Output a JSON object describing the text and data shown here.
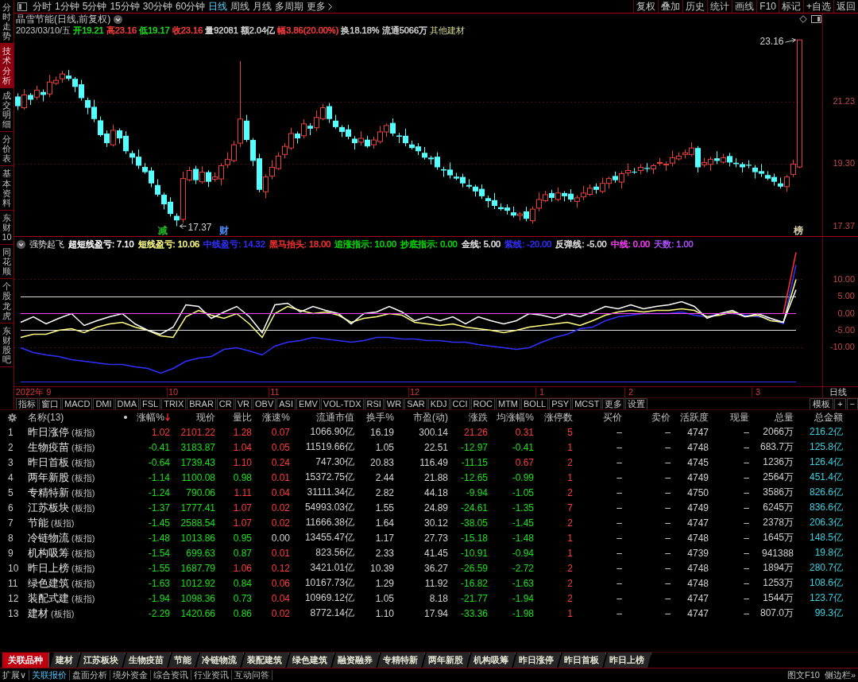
{
  "sidebar": {
    "tabs": [
      {
        "label": "分时走势",
        "selected": false
      },
      {
        "label": "技术分析",
        "selected": true
      },
      {
        "label": "成交明细",
        "selected": false
      },
      {
        "label": "分价表",
        "selected": false
      },
      {
        "label": "基本资料",
        "selected": false
      },
      {
        "label": "东财10",
        "selected": false
      },
      {
        "label": "同花顺",
        "selected": false
      },
      {
        "label": "个股龙虎",
        "selected": false
      },
      {
        "label": "东财股吧",
        "selected": false
      }
    ]
  },
  "toolbar": {
    "periods": [
      {
        "label": "分时",
        "selected": false
      },
      {
        "label": "1分钟",
        "selected": false
      },
      {
        "label": "5分钟",
        "selected": false
      },
      {
        "label": "15分钟",
        "selected": false
      },
      {
        "label": "30分钟",
        "selected": false
      },
      {
        "label": "60分钟",
        "selected": false
      },
      {
        "label": "日线",
        "selected": true
      },
      {
        "label": "周线",
        "selected": false
      },
      {
        "label": "月线",
        "selected": false
      },
      {
        "label": "多周期",
        "selected": false
      }
    ],
    "more": "更多",
    "actions": [
      "复权",
      "叠加",
      "历史",
      "统计",
      "画线",
      "F10",
      "标记",
      "+自选",
      "返回"
    ]
  },
  "price_chart": {
    "title": "晶雪节能(日线,前复权)",
    "date": "2023/03/10/五",
    "quote": [
      {
        "label": "开",
        "value": "19.21",
        "color": "#19e019"
      },
      {
        "label": "高",
        "value": "23.16",
        "color": "#ff3c3c"
      },
      {
        "label": "低",
        "value": "19.17",
        "color": "#19e019"
      },
      {
        "label": "收",
        "value": "23.16",
        "color": "#ff3c3c"
      },
      {
        "label": "量",
        "value": "92081",
        "color": "#d2d2d2"
      },
      {
        "label": "额",
        "value": "2.04亿",
        "color": "#d2d2d2"
      },
      {
        "label": "幅",
        "value": "3.86(20.00%)",
        "color": "#ff3c3c"
      },
      {
        "label": "换",
        "value": "18.18%",
        "color": "#d2d2d2"
      },
      {
        "label": "流通",
        "value": "5066万",
        "color": "#d2d2d2"
      }
    ],
    "industry": "其他建材",
    "event_marks": [
      {
        "label": "减",
        "color": "#20c020"
      },
      {
        "label": "财",
        "color": "#5090ff"
      },
      {
        "label": "榜",
        "color": "#d8d0a8"
      }
    ],
    "chart_data": {
      "type": "candlestick",
      "categories": [
        null,
        null,
        null,
        null,
        null,
        null,
        null,
        null,
        null,
        null,
        null,
        null,
        null,
        null,
        null,
        null,
        null,
        null,
        null,
        null,
        null,
        null,
        null,
        null,
        null,
        null,
        null,
        null,
        null,
        null,
        null,
        null,
        null,
        null,
        null,
        null,
        null,
        null,
        null,
        null,
        null,
        null,
        null,
        null,
        null,
        null,
        null,
        null,
        null,
        null,
        null,
        null,
        null,
        null,
        null,
        null,
        null,
        null,
        null,
        null,
        null,
        null,
        null,
        null,
        null,
        null,
        null,
        null,
        null,
        null,
        null,
        null,
        null,
        null,
        null,
        null,
        null,
        null,
        null,
        null,
        null,
        null,
        null,
        null,
        null,
        null,
        null,
        null,
        null,
        null,
        null,
        null,
        null,
        null,
        null,
        null,
        null,
        null,
        null,
        null,
        null,
        null,
        null,
        null,
        null,
        null,
        null,
        null,
        null,
        null,
        null,
        null,
        null,
        null,
        null,
        null,
        null,
        null,
        null,
        null,
        null,
        null,
        null,
        null
      ],
      "ohlc": [
        [
          21.4,
          21.5,
          20.98,
          21.1
        ],
        [
          21.05,
          21.63,
          20.99,
          21.45
        ],
        [
          21.45,
          21.51,
          21.14,
          21.3
        ],
        [
          21.38,
          21.74,
          21.3,
          21.6
        ],
        [
          21.54,
          21.62,
          21.25,
          21.45
        ],
        [
          21.48,
          22.07,
          21.38,
          21.85
        ],
        [
          21.81,
          22.02,
          21.76,
          21.9
        ],
        [
          21.95,
          22.2,
          21.83,
          22.1
        ],
        [
          22.05,
          22.23,
          21.89,
          21.95
        ],
        [
          21.95,
          22.01,
          21.54,
          21.7
        ],
        [
          21.78,
          21.92,
          21.27,
          21.35
        ],
        [
          21.29,
          21.37,
          20.85,
          21.05
        ],
        [
          21.08,
          21.3,
          20.6,
          20.7
        ],
        [
          20.66,
          20.78,
          20.15,
          20.2
        ],
        [
          20.25,
          20.35,
          19.83,
          19.95
        ],
        [
          19.9,
          20.53,
          19.84,
          20.35
        ],
        [
          20.35,
          20.41,
          19.94,
          20.1
        ],
        [
          20.18,
          20.32,
          19.62,
          19.7
        ],
        [
          19.64,
          19.72,
          19.3,
          19.5
        ],
        [
          19.53,
          19.75,
          19.15,
          19.25
        ],
        [
          19.21,
          19.33,
          19.0,
          19.05
        ],
        [
          19.1,
          19.2,
          18.58,
          18.7
        ],
        [
          18.65,
          18.83,
          18.29,
          18.35
        ],
        [
          18.35,
          18.41,
          17.89,
          18.05
        ],
        [
          18.13,
          18.27,
          17.67,
          17.75
        ],
        [
          17.69,
          17.77,
          17.37,
          17.55
        ],
        [
          17.58,
          19.07,
          17.48,
          18.85
        ],
        [
          18.81,
          19.22,
          18.76,
          19.1
        ],
        [
          19.15,
          19.25,
          18.68,
          18.8
        ],
        [
          18.75,
          19.23,
          18.69,
          19.05
        ],
        [
          19.05,
          19.11,
          18.59,
          18.75
        ],
        [
          18.83,
          19.04,
          18.75,
          18.9
        ],
        [
          18.84,
          19.33,
          18.64,
          19.25
        ],
        [
          19.28,
          19.67,
          19.18,
          19.45
        ],
        [
          19.41,
          20.02,
          19.36,
          19.9
        ],
        [
          19.95,
          22.5,
          19.83,
          20.7
        ],
        [
          20.65,
          20.83,
          19.99,
          20.05
        ],
        [
          20.05,
          20.11,
          19.24,
          19.4
        ],
        [
          19.48,
          19.62,
          18.42,
          18.5
        ],
        [
          18.44,
          18.98,
          18.24,
          18.9
        ],
        [
          18.93,
          19.42,
          18.83,
          19.2
        ],
        [
          19.16,
          19.67,
          19.11,
          19.55
        ],
        [
          19.6,
          19.95,
          19.48,
          19.85
        ],
        [
          19.8,
          20.43,
          19.74,
          20.25
        ],
        [
          20.25,
          20.31,
          19.94,
          20.1
        ],
        [
          20.18,
          20.69,
          20.1,
          20.55
        ],
        [
          20.49,
          20.57,
          20.2,
          20.4
        ],
        [
          20.43,
          20.97,
          20.33,
          20.75
        ],
        [
          20.71,
          21.17,
          20.66,
          21.05
        ],
        [
          21.1,
          21.2,
          20.58,
          20.7
        ],
        [
          20.65,
          20.83,
          20.39,
          20.45
        ],
        [
          20.45,
          20.51,
          20.14,
          20.3
        ],
        [
          20.38,
          20.52,
          20.07,
          20.15
        ],
        [
          20.09,
          20.17,
          19.75,
          19.95
        ],
        [
          19.98,
          20.32,
          19.88,
          20.1
        ],
        [
          20.06,
          20.18,
          19.8,
          19.85
        ],
        [
          19.9,
          20.15,
          19.78,
          20.05
        ],
        [
          20.0,
          20.48,
          19.94,
          20.3
        ],
        [
          20.3,
          20.56,
          20.14,
          20.5
        ],
        [
          20.58,
          20.72,
          20.17,
          20.25
        ],
        [
          20.19,
          20.27,
          19.95,
          20.15
        ],
        [
          20.18,
          20.4,
          19.85,
          19.95
        ],
        [
          19.91,
          20.03,
          19.75,
          19.8
        ],
        [
          19.85,
          19.95,
          19.58,
          19.7
        ],
        [
          19.65,
          19.83,
          19.44,
          19.5
        ],
        [
          19.5,
          19.56,
          19.29,
          19.45
        ],
        [
          19.53,
          19.67,
          19.12,
          19.2
        ],
        [
          19.14,
          19.22,
          18.9,
          19.1
        ],
        [
          19.13,
          19.35,
          18.85,
          18.95
        ],
        [
          18.91,
          19.03,
          18.8,
          18.85
        ],
        [
          18.9,
          19.0,
          18.58,
          18.7
        ],
        [
          18.65,
          18.83,
          18.54,
          18.6
        ],
        [
          18.6,
          18.66,
          18.29,
          18.45
        ],
        [
          18.53,
          18.67,
          18.22,
          18.3
        ],
        [
          18.24,
          18.32,
          17.95,
          18.15
        ],
        [
          18.18,
          18.4,
          17.9,
          18.0
        ],
        [
          17.96,
          18.08,
          17.85,
          17.9
        ],
        [
          17.95,
          18.05,
          17.73,
          17.85
        ],
        [
          17.8,
          17.98,
          17.64,
          17.7
        ],
        [
          17.7,
          17.81,
          17.54,
          17.75
        ],
        [
          17.83,
          17.97,
          17.52,
          17.6
        ],
        [
          17.54,
          17.98,
          17.45,
          17.9
        ],
        [
          17.93,
          18.42,
          17.83,
          18.2
        ],
        [
          18.16,
          18.47,
          18.11,
          18.35
        ],
        [
          18.4,
          18.5,
          18.13,
          18.25
        ],
        [
          18.2,
          18.58,
          18.14,
          18.4
        ],
        [
          18.4,
          18.46,
          18.14,
          18.3
        ],
        [
          18.38,
          18.52,
          18.12,
          18.2
        ],
        [
          18.14,
          18.33,
          17.94,
          18.25
        ],
        [
          18.28,
          18.62,
          18.18,
          18.4
        ],
        [
          18.36,
          18.67,
          18.31,
          18.55
        ],
        [
          18.6,
          18.7,
          18.38,
          18.5
        ],
        [
          18.45,
          18.88,
          18.39,
          18.7
        ],
        [
          18.7,
          18.91,
          18.54,
          18.85
        ],
        [
          18.93,
          19.07,
          18.72,
          18.8
        ],
        [
          18.74,
          19.08,
          18.54,
          19.0
        ],
        [
          19.03,
          19.32,
          18.93,
          19.1
        ],
        [
          19.06,
          19.18,
          19.0,
          19.05
        ],
        [
          19.1,
          19.3,
          18.98,
          19.2
        ],
        [
          19.18,
          19.33,
          19.05,
          19.15
        ],
        [
          19.15,
          19.31,
          18.99,
          19.25
        ],
        [
          19.33,
          19.49,
          19.25,
          19.35
        ],
        [
          19.29,
          19.38,
          19.09,
          19.3
        ],
        [
          19.33,
          19.72,
          19.23,
          19.5
        ],
        [
          19.46,
          19.67,
          19.41,
          19.55
        ],
        [
          19.6,
          19.75,
          19.48,
          19.65
        ],
        [
          19.6,
          19.98,
          19.54,
          19.8
        ],
        [
          19.8,
          19.86,
          19.04,
          19.2
        ],
        [
          19.28,
          19.49,
          19.2,
          19.35
        ],
        [
          19.29,
          19.53,
          19.09,
          19.45
        ],
        [
          19.48,
          19.7,
          19.3,
          19.4
        ],
        [
          19.36,
          19.62,
          19.31,
          19.5
        ],
        [
          19.55,
          19.65,
          19.23,
          19.35
        ],
        [
          19.34,
          19.48,
          19.2,
          19.3
        ],
        [
          19.3,
          19.36,
          19.04,
          19.2
        ],
        [
          19.28,
          19.42,
          19.17,
          19.25
        ],
        [
          19.19,
          19.27,
          18.85,
          19.05
        ],
        [
          19.08,
          19.3,
          18.9,
          19.0
        ],
        [
          18.96,
          19.08,
          18.8,
          18.85
        ],
        [
          18.9,
          19.0,
          18.63,
          18.75
        ],
        [
          18.7,
          18.88,
          18.54,
          18.6
        ],
        [
          18.6,
          18.96,
          18.44,
          18.9
        ],
        [
          18.98,
          19.44,
          18.9,
          19.3
        ],
        [
          19.21,
          23.16,
          19.17,
          23.16
        ]
      ],
      "ylim": [
        17.05,
        23.98
      ],
      "yticks": [
        {
          "value": 21.23,
          "label": "21.23"
        },
        {
          "value": 19.3,
          "label": "19.30"
        },
        {
          "value": 17.37,
          "label": "17.37"
        }
      ],
      "annotations": [
        "23.16",
        "17.37"
      ]
    }
  },
  "indicator": {
    "name": "强势起飞",
    "values": [
      {
        "label": "超短线盈亏:",
        "value": "7.10",
        "color": "#ffffff"
      },
      {
        "label": "短线盈亏:",
        "value": "10.06",
        "color": "#ffff80"
      },
      {
        "label": "中线盈亏:",
        "value": "14.32",
        "color": "#3030ff"
      },
      {
        "label": "黑马抬头:",
        "value": "18.00",
        "color": "#ff3030"
      },
      {
        "label": "追涨指示:",
        "value": "10.00",
        "color": "#00e000"
      },
      {
        "label": "抄底指示:",
        "value": "0.00",
        "color": "#00e000"
      },
      {
        "label": "金线:",
        "value": "5.00",
        "color": "#e0e0e0"
      },
      {
        "label": "紫线:",
        "value": "-20.00",
        "color": "#3030ff"
      },
      {
        "label": "反弹线:",
        "value": "-5.00",
        "color": "#e0e0e0"
      },
      {
        "label": "中线:",
        "value": "0.00",
        "color": "#ff40ff"
      },
      {
        "label": "天数:",
        "value": "1.00",
        "color": "#b050ff"
      }
    ],
    "chart_data": {
      "type": "line",
      "categories": [
        null,
        "2022年 9",
        null,
        null,
        null,
        null,
        null,
        null,
        null,
        null,
        null,
        null,
        "10",
        null,
        null,
        null,
        null,
        null,
        null,
        null,
        "11",
        null,
        null,
        null,
        null,
        null,
        null,
        null,
        null,
        null,
        null,
        "12",
        null,
        null,
        null,
        null,
        null,
        null,
        null,
        null,
        null,
        "1",
        null,
        null,
        null,
        null,
        null,
        null,
        "2",
        null,
        null,
        null,
        null,
        null,
        null,
        null,
        null,
        null,
        "3",
        null,
        null,
        null
      ],
      "ylim": [
        -21.2,
        22.6
      ],
      "yticks": [
        {
          "value": 10,
          "label": "10.00"
        },
        {
          "value": 5,
          "label": "5.00"
        },
        {
          "value": 0,
          "label": "0.00"
        },
        {
          "value": -5,
          "label": "-5.00"
        },
        {
          "value": -10,
          "label": "-10.00"
        }
      ],
      "series": [
        {
          "color": "#d8d8c0",
          "values": [
            5,
            5,
            5,
            5,
            5,
            5,
            5,
            5,
            5,
            5,
            5,
            5,
            5,
            5,
            5,
            5,
            5,
            5,
            5,
            5,
            5,
            5,
            5,
            5,
            5,
            5,
            5,
            5,
            5,
            5,
            5,
            5,
            5,
            5,
            5,
            5,
            5,
            5,
            5,
            5,
            5,
            5,
            5,
            5,
            5,
            5,
            5,
            5,
            5,
            5,
            5,
            5,
            5,
            5,
            5,
            5,
            5,
            5,
            5,
            5,
            5,
            5
          ]
        },
        {
          "color": "#e0e0e0",
          "values": [
            -5,
            -5,
            -5,
            -5,
            -5,
            -5,
            -5,
            -5,
            -5,
            -5,
            -5,
            -5,
            -5,
            -5,
            -5,
            -5,
            -5,
            -5,
            -5,
            -5,
            -5,
            -5,
            -5,
            -5,
            -5,
            -5,
            -5,
            -5,
            -5,
            -5,
            -5,
            -5,
            -5,
            -5,
            -5,
            -5,
            -5,
            -5,
            -5,
            -5,
            -5,
            -5,
            -5,
            -5,
            -5,
            -5,
            -5,
            -5,
            -5,
            -5,
            -5,
            -5,
            -5,
            -5,
            -5,
            -5,
            -5,
            -5,
            -5,
            -5,
            -5,
            -5
          ]
        },
        {
          "color": "#3030ff",
          "values": [
            -20,
            -20,
            -20,
            -20,
            -20,
            -20,
            -20,
            -20,
            -20,
            -20,
            -20,
            -20,
            -20,
            -20,
            -20,
            -20,
            -20,
            -20,
            -20,
            -20,
            -20,
            -20,
            -20,
            -20,
            -20,
            -20,
            -20,
            -20,
            -20,
            -20,
            -20,
            -20,
            -20,
            -20,
            -20,
            -20,
            -20,
            -20,
            -20,
            -20,
            -20,
            -20,
            -20,
            -20,
            -20,
            -20,
            -20,
            -20,
            -20,
            -20,
            -20,
            -20,
            -20,
            -20,
            -20,
            -20,
            -20,
            -20,
            -20,
            -20,
            -20,
            -20
          ]
        },
        {
          "color": "#3030ff",
          "values": [
            -10.0,
            -11.5,
            -12.0,
            -12.5,
            -13.5,
            -14.0,
            -14.5,
            -15.0,
            -15.0,
            -15.5,
            -16.0,
            -17.5,
            -16.0,
            -14.0,
            -13.0,
            -12.5,
            -10.5,
            -10.0,
            -11.0,
            -12.0,
            -9.5,
            -8.5,
            -8.0,
            -7.0,
            -7.5,
            -8.0,
            -8.5,
            -8.0,
            -7.0,
            -7.0,
            -7.5,
            -7.5,
            -8.0,
            -8.0,
            -8.5,
            -8.5,
            -9.0,
            -9.5,
            -10.0,
            -10.5,
            -10.0,
            -8.5,
            -7.0,
            -6.0,
            -4.5,
            -4.0,
            -2.0,
            -1.0,
            -0.5,
            0.0,
            0.0,
            0.0,
            0.5,
            -0.5,
            -1.0,
            0.0,
            0.0,
            -0.5,
            -1.0,
            -1.5,
            -3.0,
            14.3
          ]
        },
        {
          "color": "#ffff80",
          "values": [
            -7.0,
            -6.0,
            -6.0,
            -5.0,
            -4.5,
            -5.5,
            -4.0,
            -3.0,
            -2.5,
            -4.0,
            -5.0,
            -6.5,
            -7.0,
            -1.0,
            1.0,
            -0.5,
            -1.5,
            0.0,
            -3.0,
            -7.0,
            0.0,
            2.0,
            1.0,
            0.0,
            0.5,
            -0.5,
            -2.5,
            -1.5,
            -1.0,
            0.0,
            -0.5,
            -2.5,
            -3.0,
            -3.5,
            -3.0,
            -4.0,
            -4.5,
            -5.0,
            -5.5,
            -5.0,
            -4.0,
            -3.5,
            -3.0,
            -2.5,
            -3.5,
            -2.0,
            -0.5,
            0.5,
            1.0,
            0.5,
            1.0,
            1.0,
            1.5,
            1.0,
            -1.0,
            -0.5,
            0.5,
            -1.0,
            -0.5,
            -2.0,
            -2.5,
            10.1
          ]
        },
        {
          "color": "#ffffff",
          "values": [
            -2.5,
            -1.0,
            -3.0,
            -1.5,
            0.0,
            -3.5,
            -2.0,
            -1.0,
            0.0,
            -3.0,
            -5.0,
            -6.0,
            -4.0,
            2.5,
            2.0,
            -1.5,
            0.5,
            2.0,
            -1.0,
            -5.5,
            2.5,
            3.0,
            0.5,
            2.0,
            1.0,
            0.0,
            -3.0,
            0.0,
            0.5,
            2.0,
            0.5,
            -2.0,
            -1.0,
            -2.0,
            -1.0,
            -3.0,
            -1.0,
            -2.0,
            -3.0,
            -2.0,
            0.0,
            -0.5,
            -1.5,
            0.0,
            -1.0,
            0.5,
            2.0,
            1.5,
            2.5,
            1.5,
            2.0,
            2.5,
            3.5,
            2.0,
            -1.5,
            0.0,
            1.0,
            -1.0,
            0.0,
            -1.5,
            -2.5,
            7.1
          ]
        },
        {
          "color": "#ff40ff",
          "values": [
            0,
            0,
            0,
            0,
            0,
            0,
            0,
            0,
            0,
            0,
            0,
            0,
            0,
            0,
            0,
            0,
            0,
            0,
            0,
            0,
            0,
            0,
            0,
            0,
            0,
            0,
            0,
            0,
            0,
            0,
            0,
            0,
            0,
            0,
            0,
            0,
            0,
            0,
            0,
            0,
            0,
            0,
            0,
            0,
            0,
            0,
            0,
            0,
            0,
            0,
            0,
            0,
            0,
            0,
            0,
            0,
            0,
            0,
            0,
            0,
            0,
            0
          ]
        },
        {
          "color": "#ff3030",
          "values": [
            null,
            null,
            null,
            null,
            null,
            null,
            null,
            null,
            null,
            null,
            null,
            null,
            null,
            null,
            null,
            null,
            null,
            null,
            null,
            null,
            null,
            null,
            null,
            null,
            null,
            null,
            null,
            null,
            null,
            null,
            null,
            null,
            null,
            null,
            null,
            null,
            null,
            null,
            null,
            null,
            null,
            null,
            null,
            null,
            null,
            null,
            null,
            null,
            null,
            null,
            null,
            null,
            null,
            null,
            null,
            null,
            null,
            null,
            null,
            null,
            0.0,
            18.0
          ]
        }
      ]
    }
  },
  "time_axis": {
    "period": "日线"
  },
  "indicator_tabs": {
    "tabs": [
      "指标",
      "窗口",
      "MACD",
      "DMI",
      "DMA",
      "FSL",
      "TRIX",
      "BRAR",
      "CR",
      "VR",
      "OBV",
      "ASI",
      "EMV",
      "VOL-TDX",
      "RSI",
      "WR",
      "SAR",
      "KDJ",
      "CCI",
      "ROC",
      "MTM",
      "BOLL",
      "PSY",
      "MCST",
      "更多",
      "设置"
    ],
    "tools": [
      "模板",
      "+",
      "−"
    ]
  },
  "table": {
    "columns": [
      {
        "label": "名称(13)",
        "sorted": false
      },
      {
        "label": "涨幅%",
        "sorted": true
      },
      {
        "label": "现价",
        "sorted": false
      },
      {
        "label": "量比",
        "sorted": false
      },
      {
        "label": "涨速%",
        "sorted": false
      },
      {
        "label": "流通市值",
        "sorted": false
      },
      {
        "label": "换手%",
        "sorted": false
      },
      {
        "label": "市盈(动)",
        "sorted": false
      },
      {
        "label": "涨跌",
        "sorted": false
      },
      {
        "label": "均涨幅%",
        "sorted": false
      },
      {
        "label": "涨停数",
        "sorted": false
      },
      {
        "label": "买价",
        "sorted": false
      },
      {
        "label": "卖价",
        "sorted": false
      },
      {
        "label": "活跃度",
        "sorted": false
      },
      {
        "label": "现量",
        "sorted": false
      },
      {
        "label": "总量",
        "sorted": false
      },
      {
        "label": "总金额",
        "sorted": false
      }
    ],
    "rows": [
      {
        "index": "1",
        "tag": "(板指)",
        "up": true,
        "ratio_up": true,
        "speed_up": true,
        "avg_up": true,
        "cells": [
          "昨日涨停",
          "1.02",
          "2101.22",
          "1.28",
          "0.07",
          "1066.90亿",
          "16.19",
          "300.14",
          "21.26",
          "0.31",
          "5",
          "–",
          "–",
          "4747",
          "–",
          "2066万",
          "216.2亿"
        ]
      },
      {
        "index": "2",
        "tag": "(板指)",
        "up": false,
        "ratio_up": true,
        "speed_up": true,
        "avg_up": false,
        "cells": [
          "生物疫苗",
          "-0.41",
          "3183.87",
          "1.04",
          "0.05",
          "11519.66亿",
          "1.05",
          "22.51",
          "-12.97",
          "-0.41",
          "1",
          "–",
          "–",
          "4748",
          "–",
          "683.7万",
          "125.8亿"
        ]
      },
      {
        "index": "3",
        "tag": "(板指)",
        "up": false,
        "ratio_up": true,
        "speed_up": true,
        "avg_up": true,
        "cells": [
          "昨日首板",
          "-0.64",
          "1739.43",
          "1.10",
          "0.24",
          "747.30亿",
          "20.83",
          "116.49",
          "-11.15",
          "0.67",
          "2",
          "–",
          "–",
          "4745",
          "–",
          "1236万",
          "126.4亿"
        ]
      },
      {
        "index": "4",
        "tag": "(板指)",
        "up": false,
        "ratio_up": false,
        "speed_up": true,
        "avg_up": false,
        "cells": [
          "两年新股",
          "-1.14",
          "1100.08",
          "0.98",
          "0.01",
          "15372.75亿",
          "2.44",
          "21.88",
          "-12.65",
          "-0.99",
          "1",
          "–",
          "–",
          "4749",
          "–",
          "2564万",
          "451.4亿"
        ]
      },
      {
        "index": "5",
        "tag": "(板指)",
        "up": false,
        "ratio_up": true,
        "speed_up": true,
        "avg_up": false,
        "cells": [
          "专精特新",
          "-1.24",
          "790.06",
          "1.11",
          "0.04",
          "31111.34亿",
          "2.82",
          "44.18",
          "-9.94",
          "-1.05",
          "2",
          "–",
          "–",
          "4750",
          "–",
          "3586万",
          "826.6亿"
        ]
      },
      {
        "index": "6",
        "tag": "(板指)",
        "up": false,
        "ratio_up": true,
        "speed_up": true,
        "avg_up": false,
        "cells": [
          "江苏板块",
          "-1.37",
          "1777.41",
          "1.07",
          "0.02",
          "54993.03亿",
          "1.55",
          "24.89",
          "-24.61",
          "-1.35",
          "7",
          "–",
          "–",
          "4749",
          "–",
          "6245万",
          "836.6亿"
        ]
      },
      {
        "index": "7",
        "tag": "(板指)",
        "up": false,
        "ratio_up": true,
        "speed_up": true,
        "avg_up": false,
        "cells": [
          "节能",
          "-1.45",
          "2588.54",
          "1.07",
          "0.02",
          "11666.38亿",
          "1.64",
          "30.12",
          "-38.05",
          "-1.45",
          "2",
          "–",
          "–",
          "4747",
          "–",
          "2378万",
          "206.3亿"
        ]
      },
      {
        "index": "8",
        "tag": "(板指)",
        "up": false,
        "ratio_up": false,
        "speed_up": false,
        "avg_up": false,
        "cells": [
          "冷链物流",
          "-1.48",
          "1013.86",
          "0.95",
          "0.00",
          "13455.47亿",
          "1.17",
          "27.73",
          "-15.18",
          "-1.48",
          "1",
          "–",
          "–",
          "4748",
          "–",
          "1645万",
          "148.5亿"
        ]
      },
      {
        "index": "9",
        "tag": "(板指)",
        "up": false,
        "ratio_up": false,
        "speed_up": true,
        "avg_up": false,
        "cells": [
          "机构吸筹",
          "-1.54",
          "699.63",
          "0.87",
          "0.01",
          "823.56亿",
          "2.33",
          "41.45",
          "-10.91",
          "-0.94",
          "1",
          "–",
          "–",
          "4739",
          "–",
          "941388",
          "19.8亿"
        ]
      },
      {
        "index": "10",
        "tag": "(板指)",
        "up": false,
        "ratio_up": true,
        "speed_up": true,
        "avg_up": false,
        "cells": [
          "昨日上榜",
          "-1.55",
          "1687.79",
          "1.06",
          "0.12",
          "3421.01亿",
          "10.39",
          "36.27",
          "-26.59",
          "-2.72",
          "2",
          "–",
          "–",
          "4748",
          "–",
          "1894万",
          "280.7亿"
        ]
      },
      {
        "index": "11",
        "tag": "(板指)",
        "up": false,
        "ratio_up": false,
        "speed_up": true,
        "avg_up": false,
        "cells": [
          "绿色建筑",
          "-1.63",
          "1012.92",
          "0.84",
          "0.06",
          "10167.73亿",
          "1.29",
          "11.92",
          "-16.82",
          "-1.63",
          "2",
          "–",
          "–",
          "4748",
          "–",
          "1253万",
          "108.6亿"
        ]
      },
      {
        "index": "12",
        "tag": "(板指)",
        "up": false,
        "ratio_up": false,
        "speed_up": true,
        "avg_up": false,
        "cells": [
          "装配式建",
          "-1.94",
          "1098.36",
          "0.73",
          "0.04",
          "10969.12亿",
          "1.05",
          "8.18",
          "-21.77",
          "-1.94",
          "2",
          "–",
          "–",
          "4747",
          "–",
          "1544万",
          "123.7亿"
        ]
      },
      {
        "index": "13",
        "tag": "(板指)",
        "up": false,
        "ratio_up": false,
        "speed_up": true,
        "avg_up": false,
        "cells": [
          "建材",
          "-2.29",
          "1420.66",
          "0.86",
          "0.02",
          "8772.14亿",
          "1.10",
          "17.94",
          "-33.36",
          "-1.98",
          "1",
          "–",
          "–",
          "4747",
          "–",
          "807.0万",
          "99.3亿"
        ]
      }
    ]
  },
  "related_tabs": [
    {
      "label": "关联品种",
      "selected": true
    },
    {
      "label": "建材",
      "selected": false
    },
    {
      "label": "江苏板块",
      "selected": false
    },
    {
      "label": "生物疫苗",
      "selected": false
    },
    {
      "label": "节能",
      "selected": false
    },
    {
      "label": "冷链物流",
      "selected": false
    },
    {
      "label": "装配建筑",
      "selected": false
    },
    {
      "label": "绿色建筑",
      "selected": false
    },
    {
      "label": "融资融券",
      "selected": false
    },
    {
      "label": "专精特新",
      "selected": false
    },
    {
      "label": "两年新股",
      "selected": false
    },
    {
      "label": "机构吸筹",
      "selected": false
    },
    {
      "label": "昨日涨停",
      "selected": false
    },
    {
      "label": "昨日首板",
      "selected": false
    },
    {
      "label": "昨日上榜",
      "selected": false
    }
  ],
  "bottom_bar": {
    "tabs": [
      {
        "label": "扩展∨",
        "selected": false
      },
      {
        "label": "关联报价",
        "selected": true
      },
      {
        "label": "盘面分析",
        "selected": false
      },
      {
        "label": "境外资金",
        "selected": false
      },
      {
        "label": "综合资讯",
        "selected": false
      },
      {
        "label": "行业资讯",
        "selected": false
      },
      {
        "label": "互动问答",
        "selected": false
      }
    ],
    "links": [
      "图文F10",
      "侧边栏»"
    ]
  }
}
